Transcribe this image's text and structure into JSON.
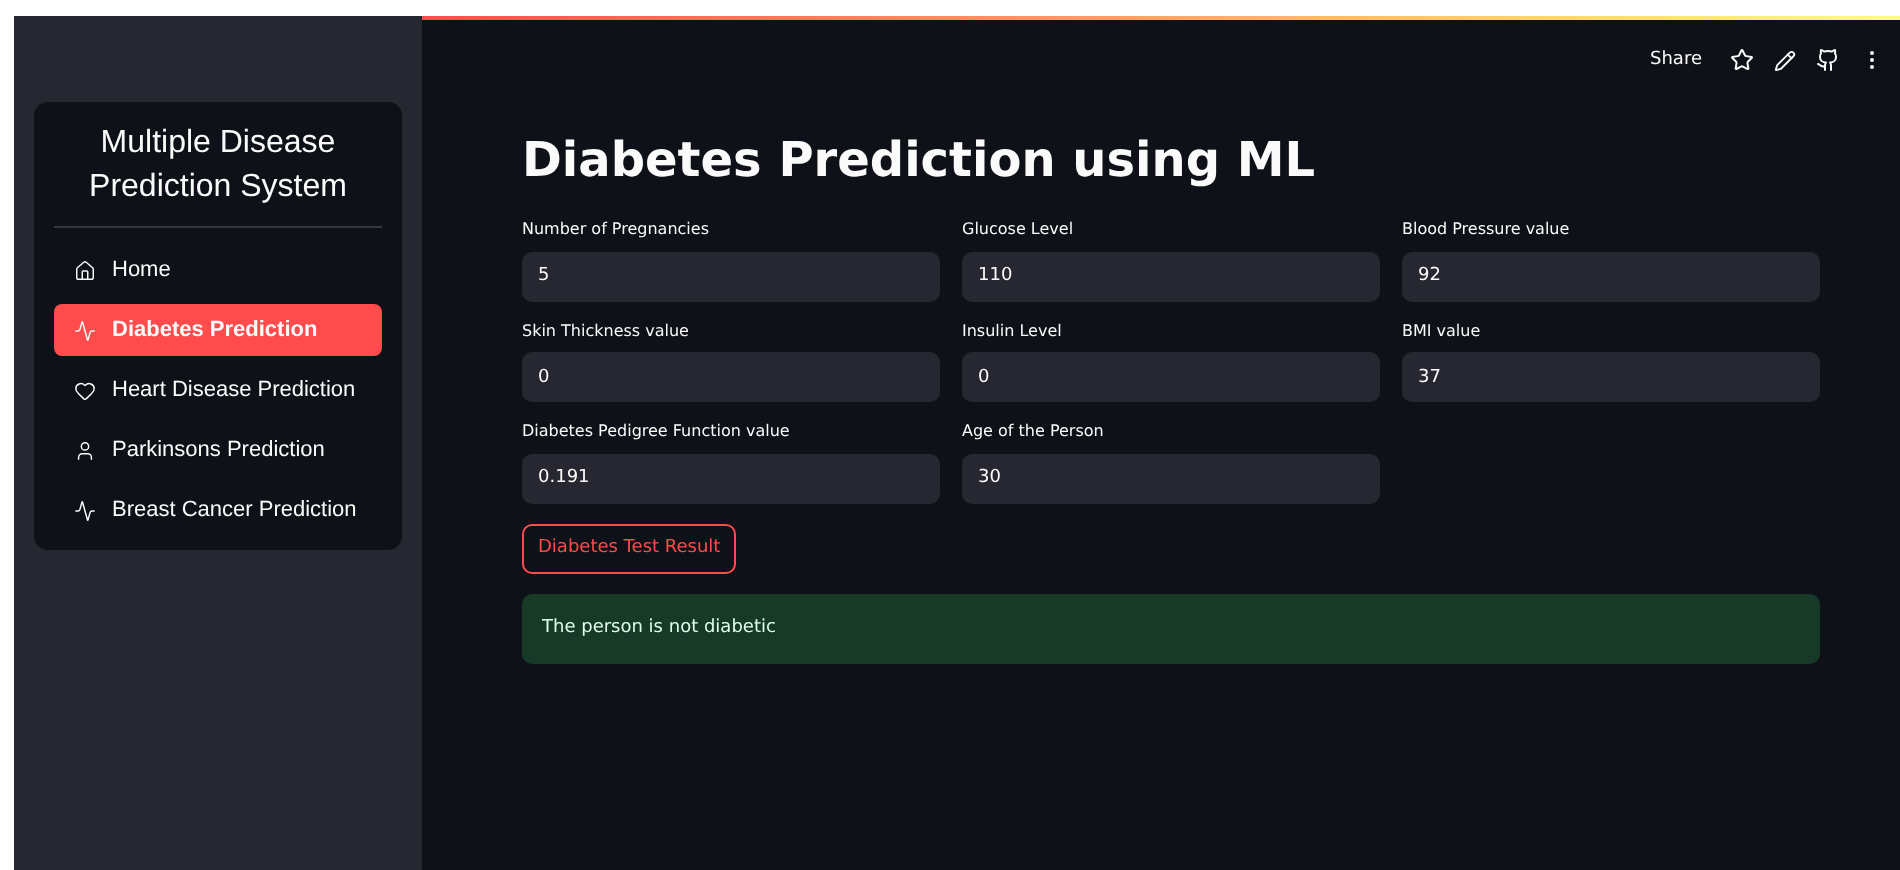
{
  "sidebar": {
    "title": "Multiple Disease Prediction System",
    "items": [
      {
        "label": "Home",
        "selected": false
      },
      {
        "label": "Diabetes Prediction",
        "selected": true
      },
      {
        "label": "Heart Disease Prediction",
        "selected": false
      },
      {
        "label": "Parkinsons Prediction",
        "selected": false
      },
      {
        "label": "Breast Cancer Prediction",
        "selected": false
      }
    ]
  },
  "header": {
    "share": "Share"
  },
  "main": {
    "title": "Diabetes Prediction using ML",
    "fields": [
      {
        "label": "Number of Pregnancies",
        "value": "5"
      },
      {
        "label": "Glucose Level",
        "value": "110"
      },
      {
        "label": "Blood Pressure value",
        "value": "92"
      },
      {
        "label": "Skin Thickness value",
        "value": "0"
      },
      {
        "label": "Insulin Level",
        "value": "0"
      },
      {
        "label": "BMI value",
        "value": "37"
      },
      {
        "label": "Diabetes Pedigree Function value",
        "value": "0.191"
      },
      {
        "label": "Age of the Person",
        "value": "30"
      }
    ],
    "button": "Diabetes Test Result",
    "result": "The person is not diabetic"
  }
}
